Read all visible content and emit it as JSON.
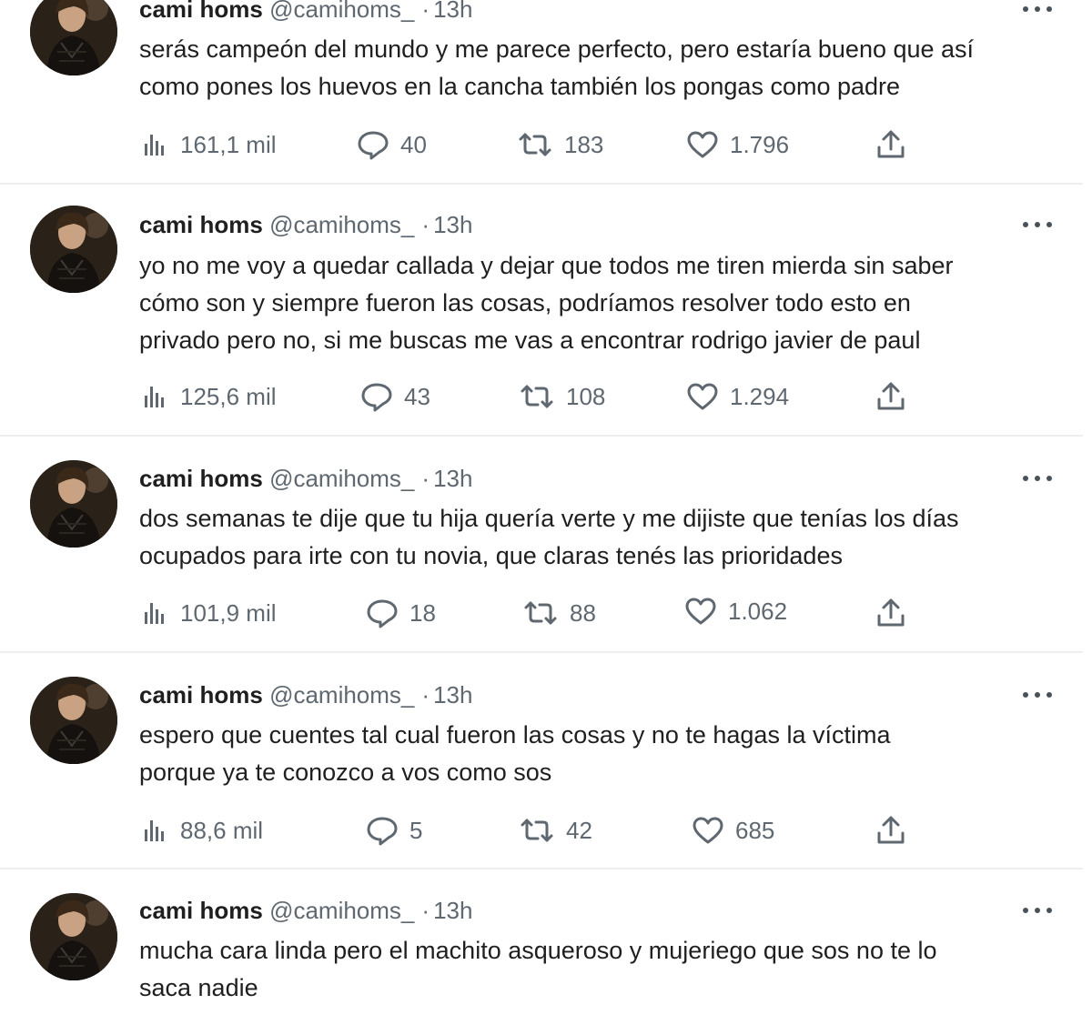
{
  "tweets": [
    {
      "name": "cami homs",
      "handle": "@camihoms_",
      "separator": "·",
      "time": "13h",
      "lines": [
        "serás campeón del mundo y me parece perfecto, pero estaría bueno que así",
        "como pones los huevos en la cancha también los pongas como padre"
      ],
      "views": "161,1 mil",
      "replies": "40",
      "retweets": "183",
      "likes": "1.796"
    },
    {
      "name": "cami homs",
      "handle": "@camihoms_",
      "separator": "·",
      "time": "13h",
      "lines": [
        "yo no me voy a quedar callada y dejar que todos me tiren mierda sin saber",
        "cómo son y siempre fueron las cosas, podríamos resolver todo esto en",
        "privado pero no, si me buscas me vas a encontrar rodrigo javier de paul"
      ],
      "views": "125,6 mil",
      "replies": "43",
      "retweets": "108",
      "likes": "1.294"
    },
    {
      "name": "cami homs",
      "handle": "@camihoms_",
      "separator": "·",
      "time": "13h",
      "lines": [
        "dos semanas te dije que tu hija quería verte y me dijiste que tenías los días",
        "ocupados para irte con tu novia, que claras tenés las prioridades"
      ],
      "views": "101,9 mil",
      "replies": "18",
      "retweets": "88",
      "likes": "1.062"
    },
    {
      "name": "cami homs",
      "handle": "@camihoms_",
      "separator": "·",
      "time": "13h",
      "lines": [
        "espero que cuentes tal cual fueron las cosas y no te hagas la víctima",
        "porque ya te conozco a vos como sos"
      ],
      "views": "88,6 mil",
      "replies": "5",
      "retweets": "42",
      "likes": "685"
    },
    {
      "name": "cami homs",
      "handle": "@camihoms_",
      "separator": "·",
      "time": "13h",
      "lines": [
        "mucha cara linda pero el machito asqueroso y mujeriego que sos no te lo",
        "saca nadie"
      ],
      "views": "",
      "replies": "",
      "retweets": "",
      "likes": ""
    }
  ],
  "icons": {
    "views": "bar-chart-icon",
    "reply": "speech-bubble-icon",
    "retweet": "retweet-arrows-icon",
    "like": "heart-outline-icon",
    "share": "upload-arrow-icon",
    "more": "ellipsis-icon",
    "avatar": "profile-photo"
  },
  "colors": {
    "text": "#1f1f1f",
    "secondary": "#5f6870",
    "divider": "#eceef0",
    "background": "#ffffff"
  }
}
